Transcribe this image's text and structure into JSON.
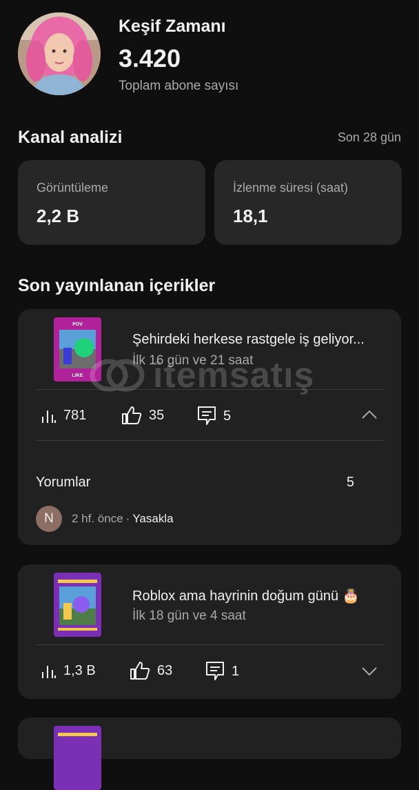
{
  "channel": {
    "name": "Keşif Zamanı",
    "subscribers": "3.420",
    "subscribers_label": "Toplam abone sayısı"
  },
  "analytics": {
    "title": "Kanal analizi",
    "range": "Son 28 gün",
    "views_label": "Görüntüleme",
    "views_value": "2,2 B",
    "watch_label": "İzlenme süresi (saat)",
    "watch_value": "18,1"
  },
  "recent": {
    "title": "Son yayınlanan içerikler",
    "items": [
      {
        "title": "Şehirdeki herkese rastgele iş geliyor...",
        "subtitle": "İlk 16 gün ve 21 saat",
        "views": "781",
        "likes": "35",
        "comments": "5",
        "thumb_top_text": "POV",
        "thumb_bottom_text": "LIKE"
      },
      {
        "title": "Roblox ama hayrinin doğum günü 🎂",
        "subtitle": "İlk 18 gün ve 4 saat",
        "views": "1,3 B",
        "likes": "63",
        "comments": "1"
      }
    ]
  },
  "comments_section": {
    "label": "Yorumlar",
    "count": "5",
    "latest": {
      "avatar_letter": "N",
      "time": "2 hf. önce",
      "separator": "·",
      "action": "Yasakla"
    }
  },
  "watermark": "itemsatış",
  "colors": {
    "background": "#0f0f0f",
    "card": "#212121",
    "stat_card": "#272727",
    "muted_text": "#aaaaaa",
    "thumbnail_purple": "#7b2fb5",
    "thumbnail_magenta": "#b0229a"
  }
}
